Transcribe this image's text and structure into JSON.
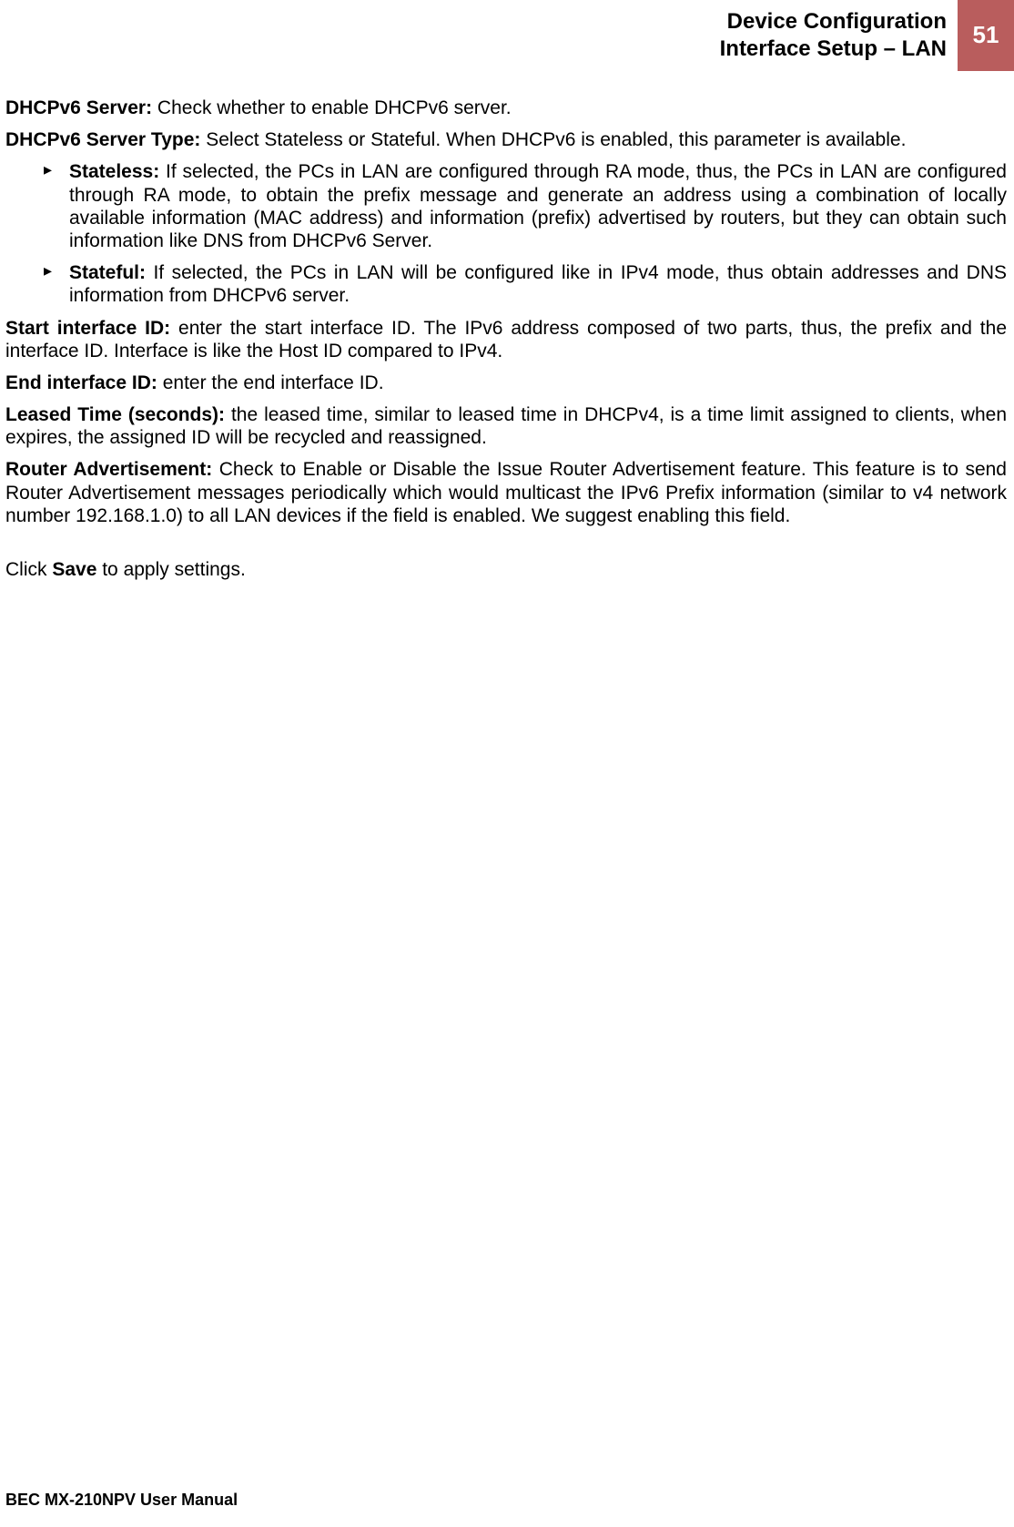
{
  "header": {
    "title_line1": "Device Configuration",
    "title_line2": "Interface Setup – LAN",
    "page_number": "51"
  },
  "sections": {
    "dhcpv6_server": {
      "label": "DHCPv6 Server:",
      "text": " Check whether to enable DHCPv6 server."
    },
    "dhcpv6_server_type": {
      "label": "DHCPv6 Server Type:",
      "text": " Select Stateless or Stateful. When DHCPv6 is enabled, this parameter is available."
    },
    "stateless": {
      "label": "Stateless:",
      "text": " If selected, the PCs in LAN are configured through RA mode, thus, the PCs in LAN are configured through RA mode, to obtain the prefix message and generate an address using a combination of locally available information (MAC address) and information (prefix) advertised by routers, but they can obtain such information like DNS from DHCPv6 Server."
    },
    "stateful": {
      "label": "Stateful:",
      "text": " If selected, the PCs in LAN will be configured like in IPv4 mode, thus obtain addresses and DNS information from DHCPv6 server."
    },
    "start_interface_id": {
      "label": "Start interface ID:",
      "text": " enter the start interface ID. The IPv6 address composed of two parts, thus, the prefix and the interface ID. Interface is like the Host ID compared to IPv4."
    },
    "end_interface_id": {
      "label": "End interface ID:",
      "text": " enter the end interface ID."
    },
    "leased_time": {
      "label": "Leased Time (seconds):",
      "text": " the leased time, similar to leased time in DHCPv4, is a time limit assigned to clients, when expires, the assigned ID will be recycled and reassigned."
    },
    "router_advertisement": {
      "label": "Router Advertisement:",
      "text": " Check to Enable or Disable the Issue Router Advertisement feature. This feature is to send Router Advertisement messages periodically which would multicast the IPv6 Prefix information (similar to v4 network number 192.168.1.0) to all LAN devices if the field is enabled. We suggest enabling this field."
    },
    "click_save": {
      "prefix": "Click ",
      "bold": "Save",
      "suffix": " to apply settings."
    }
  },
  "footer": {
    "text": "BEC MX-210NPV User Manual"
  }
}
